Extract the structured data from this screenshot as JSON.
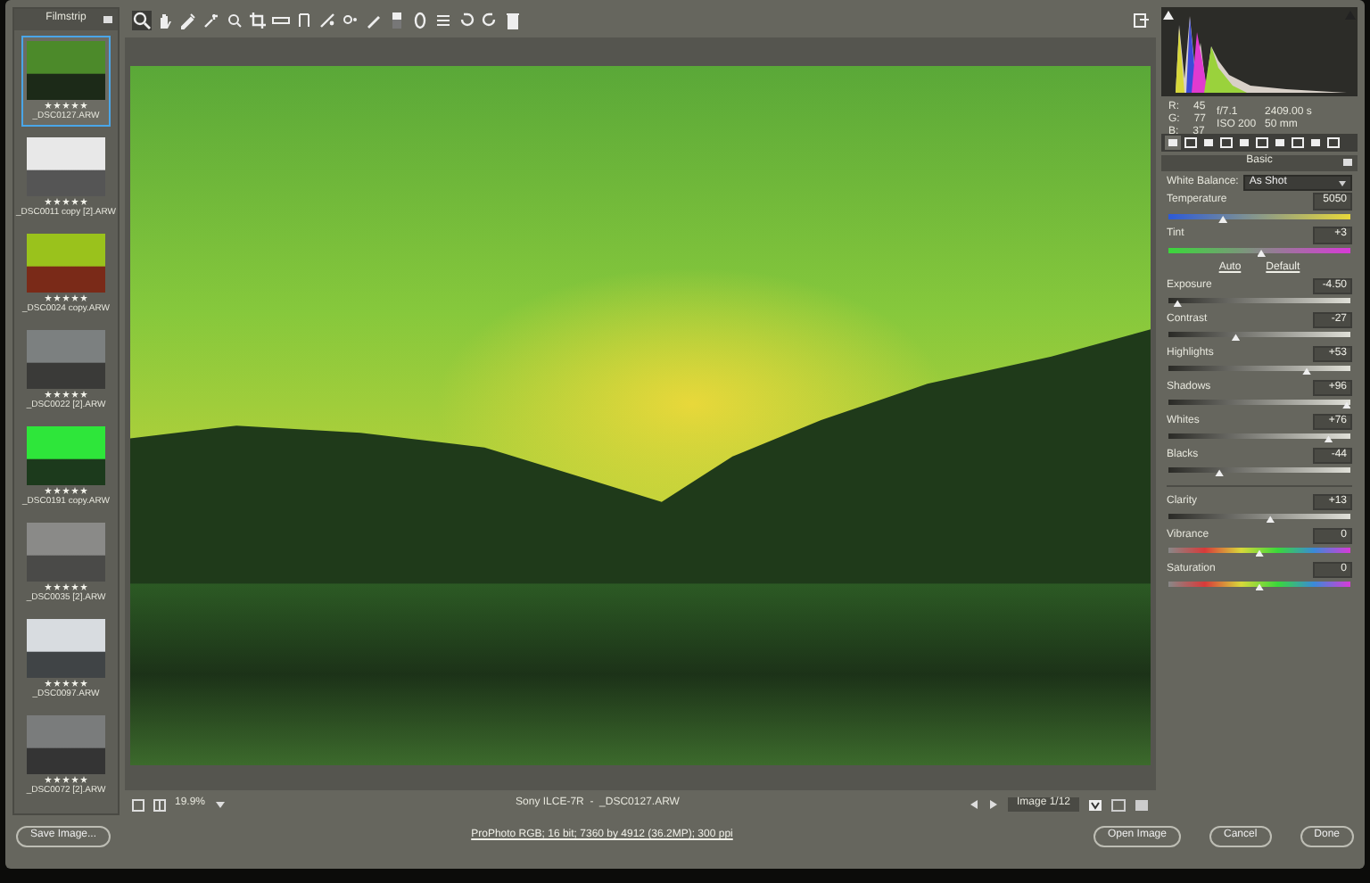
{
  "filmstrip": {
    "title": "Filmstrip",
    "items": [
      {
        "name": "_DSC0127.ARW",
        "selected": true,
        "stars": 5
      },
      {
        "name": "_DSC0011 copy [2].ARW",
        "selected": false,
        "stars": 5
      },
      {
        "name": "_DSC0024 copy.ARW",
        "selected": false,
        "stars": 5
      },
      {
        "name": "_DSC0022 [2].ARW",
        "selected": false,
        "stars": 5
      },
      {
        "name": "_DSC0191 copy.ARW",
        "selected": false,
        "stars": 5
      },
      {
        "name": "_DSC0035 [2].ARW",
        "selected": false,
        "stars": 5
      },
      {
        "name": "_DSC0097.ARW",
        "selected": false,
        "stars": 5
      },
      {
        "name": "_DSC0072 [2].ARW",
        "selected": false,
        "stars": 5
      }
    ]
  },
  "info": {
    "rgb": [
      {
        "label": "R:",
        "value": "45"
      },
      {
        "label": "G:",
        "value": "77"
      },
      {
        "label": "B:",
        "value": "37"
      }
    ],
    "exif": [
      "f/7.1",
      "2409.00 s",
      "ISO 200",
      "50 mm"
    ]
  },
  "panel_tabs": [
    {
      "selected": true
    },
    {
      "selected": false
    },
    {
      "selected": false
    },
    {
      "selected": false
    },
    {
      "selected": false
    },
    {
      "selected": false
    },
    {
      "selected": false
    },
    {
      "selected": false
    },
    {
      "selected": false
    },
    {
      "selected": false
    }
  ],
  "panel_title": "Basic",
  "white_balance": {
    "label": "White Balance:",
    "value": "As Shot"
  },
  "wb_sliders": [
    {
      "label": "Temperature",
      "value": "5050",
      "level": 0.3,
      "kind": "temperature"
    },
    {
      "label": "Tint",
      "value": "+3",
      "level": 0.51,
      "kind": "tint"
    }
  ],
  "links": [
    "Auto",
    "Default"
  ],
  "tone_sliders": [
    {
      "label": "Exposure",
      "value": "-4.50",
      "level": 0.05,
      "kind": "tone"
    },
    {
      "label": "Contrast",
      "value": "-27",
      "level": 0.37,
      "kind": "tone"
    },
    {
      "label": "Highlights",
      "value": "+53",
      "level": 0.76,
      "kind": "tone"
    },
    {
      "label": "Shadows",
      "value": "+96",
      "level": 0.98,
      "kind": "tone"
    },
    {
      "label": "Whites",
      "value": "+76",
      "level": 0.88,
      "kind": "tone"
    },
    {
      "label": "Blacks",
      "value": "-44",
      "level": 0.28,
      "kind": "tone"
    }
  ],
  "presence_sliders": [
    {
      "label": "Clarity",
      "value": "+13",
      "level": 0.56,
      "kind": "tone"
    },
    {
      "label": "Vibrance",
      "value": "0",
      "level": 0.5,
      "kind": "color"
    },
    {
      "label": "Saturation",
      "value": "0",
      "level": 0.5,
      "kind": "color"
    }
  ],
  "status": {
    "zoom": "19.9%",
    "file": "Sony ILCE-7R  -  _DSC0127.ARW",
    "nav": "Image 1/12"
  },
  "footer": {
    "save": "Save Image...",
    "workflow": "ProPhoto RGB; 16 bit; 7360 by 4912 (36.2MP); 300 ppi",
    "buttons": [
      "Open Image",
      "Cancel",
      "Done"
    ]
  }
}
